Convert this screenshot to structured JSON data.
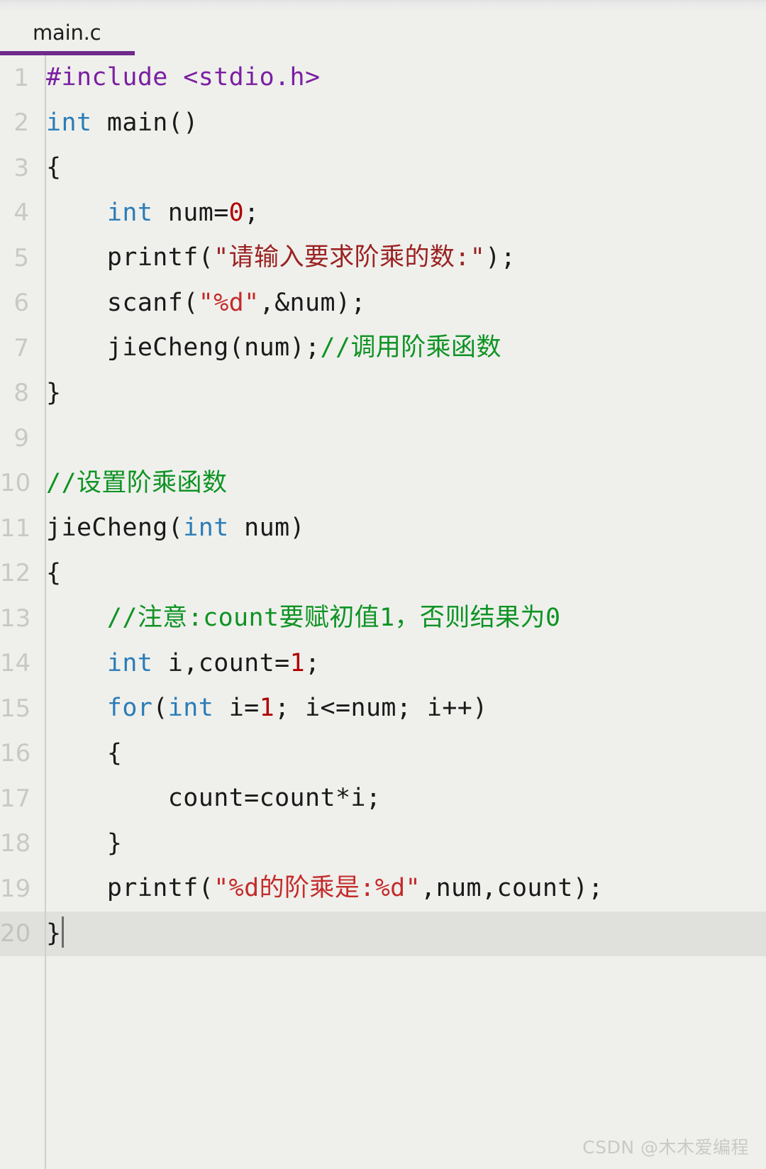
{
  "window": {
    "background_color": "#eff0ec",
    "accent_color": "#6f2a8a"
  },
  "tab_bar": {
    "active_tab": "main.c",
    "tabs": [
      "main.c"
    ]
  },
  "editor": {
    "active_line": 20,
    "total_lines": 20,
    "language": "C",
    "colors": {
      "preprocessor": "#7b1fa2",
      "keyword": "#2b7cb8",
      "number": "#b00000",
      "string": "#9b2222",
      "string_alt": "#c42b2b",
      "comment": "#0f9324",
      "plain": "#1a1a1a",
      "line_number": "#c8c9c5",
      "active_line_bg": "#e0e1dd"
    },
    "lines": [
      {
        "n": "1",
        "text": "#include <stdio.h>"
      },
      {
        "n": "2",
        "text": "int main()"
      },
      {
        "n": "3",
        "text": "{"
      },
      {
        "n": "4",
        "text": "    int num=0;"
      },
      {
        "n": "5",
        "text": "    printf(\"请输入要求阶乘的数:\");"
      },
      {
        "n": "6",
        "text": "    scanf(\"%d\",&num);"
      },
      {
        "n": "7",
        "text": "    jieCheng(num);//调用阶乘函数"
      },
      {
        "n": "8",
        "text": "}"
      },
      {
        "n": "9",
        "text": ""
      },
      {
        "n": "10",
        "text": "//设置阶乘函数"
      },
      {
        "n": "11",
        "text": "jieCheng(int num)"
      },
      {
        "n": "12",
        "text": "{"
      },
      {
        "n": "13",
        "text": "    //注意:count要赋初值1，否则结果为0"
      },
      {
        "n": "14",
        "text": "    int i,count=1;"
      },
      {
        "n": "15",
        "text": "    for(int i=1; i<=num; i++)"
      },
      {
        "n": "16",
        "text": "    {"
      },
      {
        "n": "17",
        "text": "        count=count*i;"
      },
      {
        "n": "18",
        "text": "    }"
      },
      {
        "n": "19",
        "text": "    printf(\"%d的阶乘是:%d\",num,count);"
      },
      {
        "n": "20",
        "text": "}"
      }
    ],
    "tokens": [
      [
        {
          "t": "#include <stdio.h>",
          "c": "tok-pre"
        }
      ],
      [
        {
          "t": "int",
          "c": "tok-kw"
        },
        {
          "t": " main()",
          "c": "tok-plain"
        }
      ],
      [
        {
          "t": "{",
          "c": "tok-plain"
        }
      ],
      [
        {
          "t": "    ",
          "c": "tok-plain"
        },
        {
          "t": "int",
          "c": "tok-kw"
        },
        {
          "t": " num=",
          "c": "tok-plain"
        },
        {
          "t": "0",
          "c": "tok-num"
        },
        {
          "t": ";",
          "c": "tok-plain"
        }
      ],
      [
        {
          "t": "    printf(",
          "c": "tok-plain"
        },
        {
          "t": "\"请输入要求阶乘的数:\"",
          "c": "tok-str"
        },
        {
          "t": ");",
          "c": "tok-plain"
        }
      ],
      [
        {
          "t": "    scanf(",
          "c": "tok-plain"
        },
        {
          "t": "\"%d\"",
          "c": "tok-str2"
        },
        {
          "t": ",&num);",
          "c": "tok-plain"
        }
      ],
      [
        {
          "t": "    jieCheng(num);",
          "c": "tok-plain"
        },
        {
          "t": "//调用阶乘函数",
          "c": "tok-cmt"
        }
      ],
      [
        {
          "t": "}",
          "c": "tok-plain"
        }
      ],
      [
        {
          "t": "",
          "c": "tok-plain"
        }
      ],
      [
        {
          "t": "//设置阶乘函数",
          "c": "tok-cmt"
        }
      ],
      [
        {
          "t": "jieCheng(",
          "c": "tok-plain"
        },
        {
          "t": "int",
          "c": "tok-kw"
        },
        {
          "t": " num)",
          "c": "tok-plain"
        }
      ],
      [
        {
          "t": "{",
          "c": "tok-plain"
        }
      ],
      [
        {
          "t": "    ",
          "c": "tok-plain"
        },
        {
          "t": "//注意:count要赋初值1，否则结果为0",
          "c": "tok-cmt"
        }
      ],
      [
        {
          "t": "    ",
          "c": "tok-plain"
        },
        {
          "t": "int",
          "c": "tok-kw"
        },
        {
          "t": " i,count=",
          "c": "tok-plain"
        },
        {
          "t": "1",
          "c": "tok-num"
        },
        {
          "t": ";",
          "c": "tok-plain"
        }
      ],
      [
        {
          "t": "    ",
          "c": "tok-plain"
        },
        {
          "t": "for",
          "c": "tok-kw"
        },
        {
          "t": "(",
          "c": "tok-plain"
        },
        {
          "t": "int",
          "c": "tok-kw"
        },
        {
          "t": " i=",
          "c": "tok-plain"
        },
        {
          "t": "1",
          "c": "tok-num"
        },
        {
          "t": "; i<=num; i++)",
          "c": "tok-plain"
        }
      ],
      [
        {
          "t": "    {",
          "c": "tok-plain"
        }
      ],
      [
        {
          "t": "        count=count*i;",
          "c": "tok-plain"
        }
      ],
      [
        {
          "t": "    }",
          "c": "tok-plain"
        }
      ],
      [
        {
          "t": "    printf(",
          "c": "tok-plain"
        },
        {
          "t": "\"%d的阶乘是:%d\"",
          "c": "tok-str2"
        },
        {
          "t": ",num,count);",
          "c": "tok-plain"
        }
      ],
      [
        {
          "t": "}",
          "c": "tok-plain"
        }
      ]
    ]
  },
  "watermark": {
    "text": "CSDN @木木爱编程"
  }
}
